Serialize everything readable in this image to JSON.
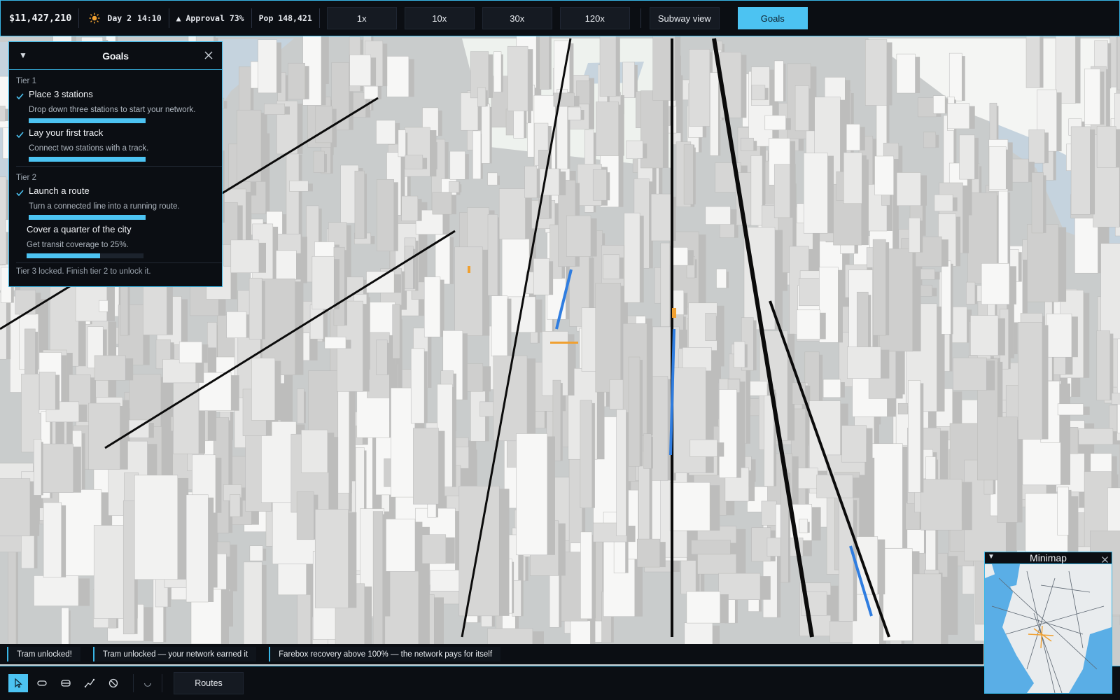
{
  "topbar": {
    "money": "$11,427,210",
    "day": "Day 2",
    "time": "14:10",
    "approval": "▲ Approval 73%",
    "population": "Pop 148,421",
    "speeds": [
      "1x",
      "10x",
      "30x",
      "120x"
    ],
    "subway_view_label": "Subway view",
    "goals_label": "Goals"
  },
  "goals_panel": {
    "title": "Goals",
    "tiers": [
      {
        "label": "Tier 1",
        "goals": [
          {
            "title": "Place 3 stations",
            "desc": "Drop down three stations to start your network.",
            "done": true,
            "progress": 1.0
          },
          {
            "title": "Lay your first track",
            "desc": "Connect two stations with a track.",
            "done": true,
            "progress": 1.0
          }
        ]
      },
      {
        "label": "Tier 2",
        "goals": [
          {
            "title": "Launch a route",
            "desc": "Turn a connected line into a running route.",
            "done": true,
            "progress": 1.0
          },
          {
            "title": "Cover a quarter of the city",
            "desc": "Get transit coverage to 25%.",
            "done": false,
            "progress": 0.63
          }
        ]
      }
    ],
    "locked_note": "Tier 3 locked. Finish tier 2 to unlock it."
  },
  "notifications": [
    "Tram unlocked!",
    "Tram unlocked — your network earned it",
    "Farebox recovery above 100% — the network pays for itself"
  ],
  "toolbar": {
    "tools": [
      "select-tool",
      "station-tool",
      "depot-tool",
      "track-tool",
      "demolish-tool"
    ],
    "routes_label": "Routes"
  },
  "minimap": {
    "title": "Minimap"
  },
  "colors": {
    "accent": "#4cc3f2",
    "panel_bg": "#0b0e13",
    "route_blue": "#2f7de0",
    "route_orange": "#f0a030"
  }
}
